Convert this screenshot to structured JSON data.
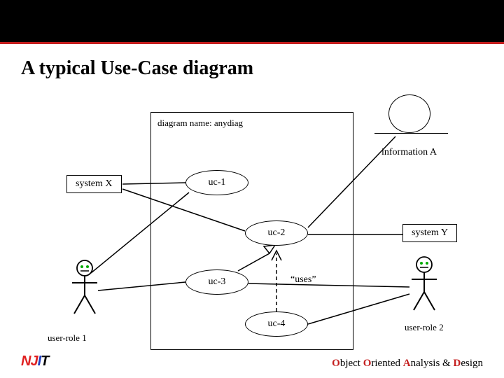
{
  "title": "A typical Use-Case diagram",
  "diagram": {
    "name_label": "diagram name: anydiag",
    "actors": {
      "system_x": "system X",
      "system_y": "system Y",
      "information_a": "information A",
      "user_role_1": "user-role 1",
      "user_role_2": "user-role 2"
    },
    "use_cases": {
      "uc1": "uc-1",
      "uc2": "uc-2",
      "uc3": "uc-3",
      "uc4": "uc-4"
    },
    "relations": {
      "uses": "“uses”"
    }
  },
  "footer": {
    "logo": {
      "n": "N",
      "j": "J",
      "i": "I",
      "t": "T"
    },
    "tagline": {
      "o1": "O",
      "t1": "bject ",
      "o2": "O",
      "t2": "riented ",
      "a": "A",
      "t3": "nalysis & ",
      "d": "D",
      "t4": "esign"
    }
  }
}
